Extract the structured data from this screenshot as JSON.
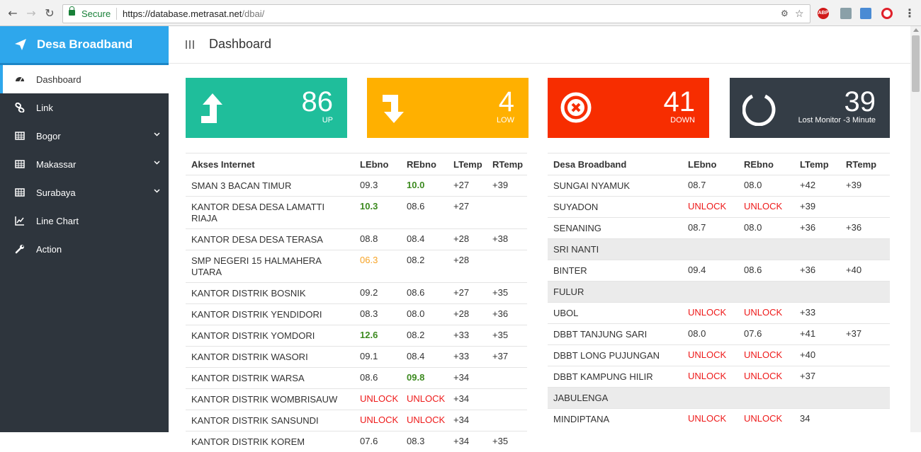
{
  "browser": {
    "secure_label": "Secure",
    "url_host": "https://database.metrasat.net",
    "url_path": "/dbai/",
    "extensions": [
      "ABP"
    ]
  },
  "sidebar": {
    "brand": "Desa Broadband",
    "items": [
      {
        "label": "Dashboard",
        "icon": "dashboard-icon",
        "active": true
      },
      {
        "label": "Link",
        "icon": "link-icon"
      },
      {
        "label": "Bogor",
        "icon": "table-icon",
        "has_submenu": true
      },
      {
        "label": "Makassar",
        "icon": "table-icon",
        "has_submenu": true
      },
      {
        "label": "Surabaya",
        "icon": "table-icon",
        "has_submenu": true
      },
      {
        "label": "Line Chart",
        "icon": "line-chart-icon"
      },
      {
        "label": "Action",
        "icon": "wrench-icon"
      }
    ]
  },
  "header": {
    "title": "Dashboard"
  },
  "cards": [
    {
      "value": "86",
      "label": "UP",
      "color": "#1fbe9b",
      "icon": "arrow-up-icon"
    },
    {
      "value": "4",
      "label": "LOW",
      "color": "#ffb000",
      "icon": "arrow-down-icon"
    },
    {
      "value": "41",
      "label": "DOWN",
      "color": "#f72d00",
      "icon": "times-circle-icon"
    },
    {
      "value": "39",
      "label": "Lost Monitor -3 Minute",
      "color": "#343d46",
      "icon": "circle-notch-icon"
    }
  ],
  "left_table": {
    "headers": [
      "Akses Internet",
      "LEbno",
      "REbno",
      "LTemp",
      "RTemp"
    ],
    "rows": [
      {
        "name": "SMAN 3 BACAN TIMUR",
        "lebno": "09.3",
        "rebno": "10.0",
        "ltemp": "+27",
        "rtemp": "+39",
        "rebno_style": "green"
      },
      {
        "name": "KANTOR DESA DESA LAMATTI RIAJA",
        "lebno": "10.3",
        "rebno": "08.6",
        "ltemp": "+27",
        "rtemp": "",
        "lebno_style": "green"
      },
      {
        "name": "KANTOR DESA DESA TERASA",
        "lebno": "08.8",
        "rebno": "08.4",
        "ltemp": "+28",
        "rtemp": "+38"
      },
      {
        "name": "SMP NEGERI 15 HALMAHERA UTARA",
        "lebno": "06.3",
        "rebno": "08.2",
        "ltemp": "+28",
        "rtemp": "",
        "lebno_style": "orange"
      },
      {
        "name": "KANTOR DISTRIK BOSNIK",
        "lebno": "09.2",
        "rebno": "08.6",
        "ltemp": "+27",
        "rtemp": "+35"
      },
      {
        "name": "KANTOR DISTRIK YENDIDORI",
        "lebno": "08.3",
        "rebno": "08.0",
        "ltemp": "+28",
        "rtemp": "+36"
      },
      {
        "name": "KANTOR DISTRIK YOMDORI",
        "lebno": "12.6",
        "rebno": "08.2",
        "ltemp": "+33",
        "rtemp": "+35",
        "lebno_style": "green"
      },
      {
        "name": "KANTOR DISTRIK WASORI",
        "lebno": "09.1",
        "rebno": "08.4",
        "ltemp": "+33",
        "rtemp": "+37"
      },
      {
        "name": "KANTOR DISTRIK WARSA",
        "lebno": "08.6",
        "rebno": "09.8",
        "ltemp": "+34",
        "rtemp": "",
        "rebno_style": "green"
      },
      {
        "name": "KANTOR DISTRIK WOMBRISAUW",
        "lebno": "UNLOCK",
        "rebno": "UNLOCK",
        "ltemp": "+34",
        "rtemp": "",
        "lebno_style": "red",
        "rebno_style": "red"
      },
      {
        "name": "KANTOR DISTRIK SANSUNDI",
        "lebno": "UNLOCK",
        "rebno": "UNLOCK",
        "ltemp": "+34",
        "rtemp": "",
        "lebno_style": "red",
        "rebno_style": "red"
      },
      {
        "name": "KANTOR DISTRIK KOREM",
        "lebno": "07.6",
        "rebno": "08.3",
        "ltemp": "+34",
        "rtemp": "+35"
      }
    ]
  },
  "right_table": {
    "headers": [
      "Desa Broadband",
      "LEbno",
      "REbno",
      "LTemp",
      "RTemp"
    ],
    "rows": [
      {
        "name": "SUNGAI NYAMUK",
        "lebno": "08.7",
        "rebno": "08.0",
        "ltemp": "+42",
        "rtemp": "+39"
      },
      {
        "name": "SUYADON",
        "lebno": "UNLOCK",
        "rebno": "UNLOCK",
        "ltemp": "+39",
        "rtemp": "",
        "lebno_style": "red",
        "rebno_style": "red"
      },
      {
        "name": "SENANING",
        "lebno": "08.7",
        "rebno": "08.0",
        "ltemp": "+36",
        "rtemp": "+36"
      },
      {
        "name": "SRI NANTI",
        "lebno": "",
        "rebno": "",
        "ltemp": "",
        "rtemp": "",
        "group": true
      },
      {
        "name": "BINTER",
        "lebno": "09.4",
        "rebno": "08.6",
        "ltemp": "+36",
        "rtemp": "+40"
      },
      {
        "name": "FULUR",
        "lebno": "",
        "rebno": "",
        "ltemp": "",
        "rtemp": "",
        "group": true
      },
      {
        "name": "UBOL",
        "lebno": "UNLOCK",
        "rebno": "UNLOCK",
        "ltemp": "+33",
        "rtemp": "",
        "lebno_style": "red",
        "rebno_style": "red"
      },
      {
        "name": "DBBT TANJUNG SARI",
        "lebno": "08.0",
        "rebno": "07.6",
        "ltemp": "+41",
        "rtemp": "+37"
      },
      {
        "name": "DBBT LONG PUJUNGAN",
        "lebno": "UNLOCK",
        "rebno": "UNLOCK",
        "ltemp": "+40",
        "rtemp": "",
        "lebno_style": "red",
        "rebno_style": "red"
      },
      {
        "name": "DBBT KAMPUNG HILIR",
        "lebno": "UNLOCK",
        "rebno": "UNLOCK",
        "ltemp": "+37",
        "rtemp": "",
        "lebno_style": "red",
        "rebno_style": "red"
      },
      {
        "name": "JABULENGA",
        "lebno": "",
        "rebno": "",
        "ltemp": "",
        "rtemp": "",
        "group": true
      },
      {
        "name": "MINDIPTANA",
        "lebno": "UNLOCK",
        "rebno": "UNLOCK",
        "ltemp": "34",
        "rtemp": "",
        "lebno_style": "red",
        "rebno_style": "red"
      }
    ]
  }
}
